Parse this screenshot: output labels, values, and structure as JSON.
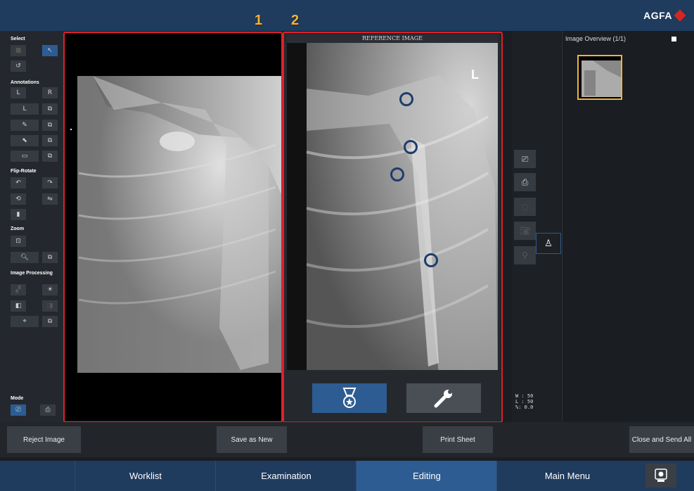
{
  "brand": {
    "name": "AGFA"
  },
  "callouts": [
    "1",
    "2"
  ],
  "left_panel": {
    "sections": [
      "Select",
      "Annotations",
      "Flip-Rotate",
      "Zoom",
      "Image Processing",
      "Mode"
    ],
    "annotation_labels": {
      "l": "L",
      "r": "R",
      "l2": "L"
    }
  },
  "reference": {
    "header": "REFERENCE IMAGE",
    "side_marker": "L"
  },
  "window_level": {
    "w": "W : 50",
    "l": "L : 50",
    "pct": "%: 0.0"
  },
  "overview": {
    "title": "Image Overview (1/1)"
  },
  "actions": {
    "reject": "Reject Image",
    "save_new": "Save as New",
    "print": "Print Sheet",
    "close_send": "Close and Send All"
  },
  "nav": {
    "tabs": [
      {
        "label": "Worklist"
      },
      {
        "label": "Examination"
      },
      {
        "label": "Editing"
      },
      {
        "label": "Main Menu"
      }
    ],
    "active": "Editing"
  },
  "colors": {
    "accent": "#2d5c93",
    "highlight": "#f0b43a",
    "frame": "#e0202a",
    "topbar": "#1f3b5e"
  }
}
